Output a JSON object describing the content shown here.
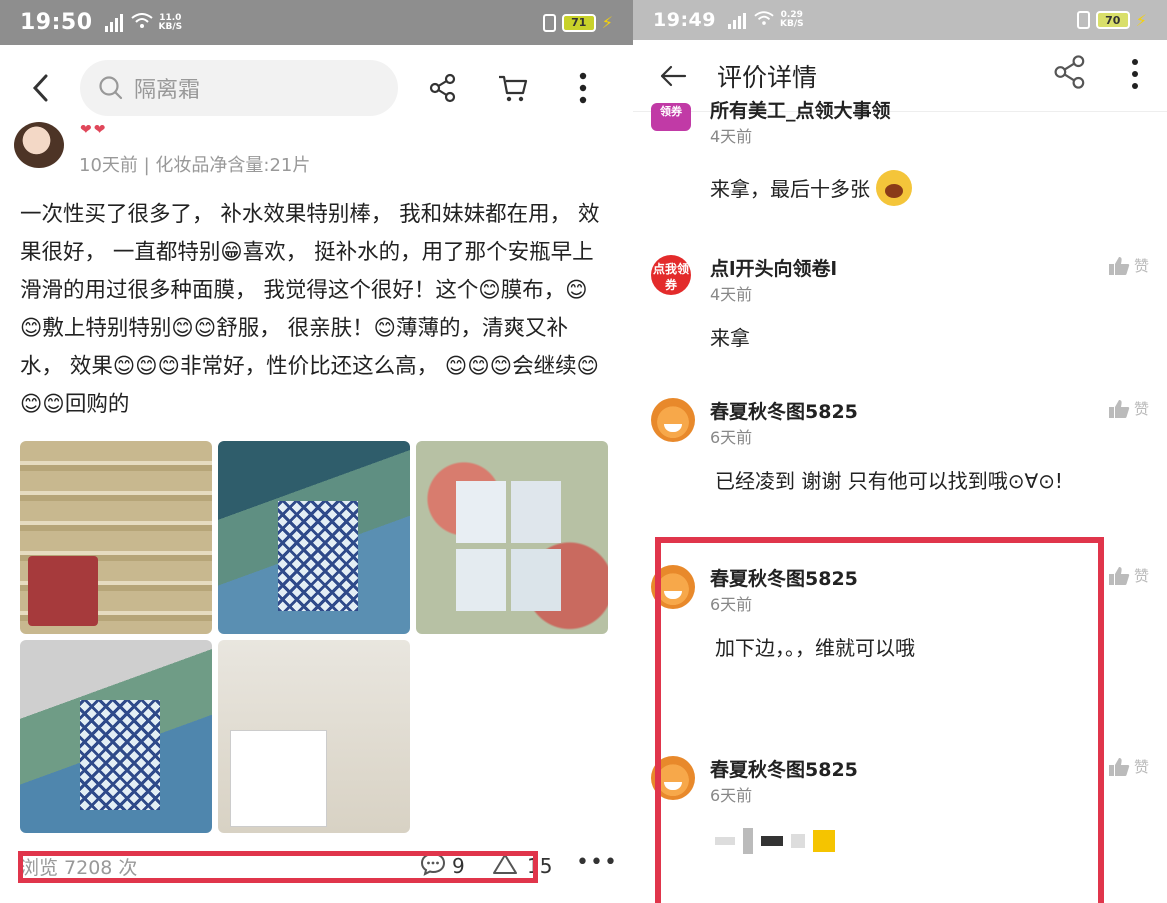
{
  "left": {
    "status": {
      "time": "19:50",
      "netspeed_value": "11.0",
      "netspeed_unit": "KB/S",
      "battery": "71"
    },
    "search": {
      "placeholder": "隔离霜"
    },
    "review": {
      "meta": "10天前 | 化妆品净含量:21片",
      "text": "一次性买了很多了， 补水效果特别棒， 我和妹妹都在用， 效果很好， 一直都特别😁喜欢， 挺补水的，用了那个安瓶早上滑滑的用过很多种面膜， 我觉得这个很好！这个😊膜布，😊😊敷上特别特别😊😊舒服， 很亲肤！😊薄薄的，清爽又补水， 效果😊😊😊非常好，性价比还这么高， 😊😊😊会继续😊😊😊回购的",
      "photo_count": 5
    },
    "stats": {
      "views": "浏览 7208 次",
      "comments": "9",
      "likes": "15"
    },
    "icons": [
      "back-chevron-icon",
      "search-icon",
      "share-icon",
      "cart-icon",
      "more-vertical-icon",
      "comment-icon",
      "like-triangle-icon",
      "more-horizontal-icon"
    ]
  },
  "right": {
    "status": {
      "time": "19:49",
      "netspeed_value": "0.29",
      "netspeed_unit": "KB/S",
      "battery": "70"
    },
    "title": "评价详情",
    "like_label": "赞",
    "comments": [
      {
        "avatar": "领券",
        "name": "所有美工_点领大事领",
        "time": "4天前",
        "text": "来拿，最后十多张"
      },
      {
        "avatar": "点我领券",
        "name": "点l开头向领卷l",
        "time": "4天前",
        "text": "来拿"
      },
      {
        "name": "春夏秋冬图5825",
        "time": "6天前",
        "text": "已经凌到 谢谢 只有他可以找到哦⊙∀⊙!"
      },
      {
        "name": "春夏秋冬图5825",
        "time": "6天前",
        "text": "加下边，。，维就可以哦"
      },
      {
        "name": "春夏秋冬图5825",
        "time": "6天前",
        "text": ""
      }
    ],
    "icons": [
      "back-arrow-icon",
      "share-icon",
      "more-vertical-icon",
      "thumbs-up-icon"
    ]
  },
  "colors": {
    "highlight": "#e0354b",
    "statusbar_left": "#8e8e8e",
    "statusbar_right": "#bdbdbd"
  }
}
